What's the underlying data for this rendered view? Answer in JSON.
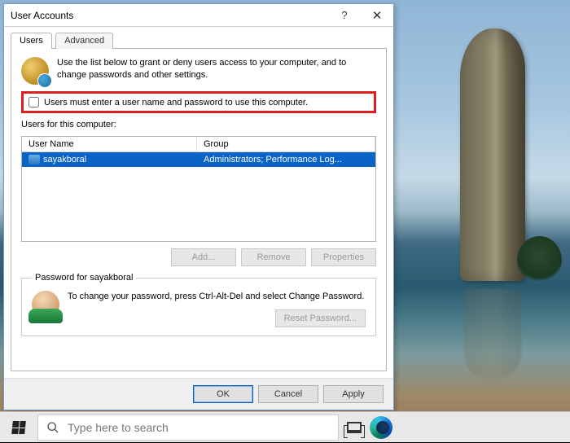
{
  "dialog": {
    "title": "User Accounts",
    "tabs": {
      "users": "Users",
      "advanced": "Advanced"
    },
    "intro": "Use the list below to grant or deny users access to your computer, and to change passwords and other settings.",
    "checkbox_label": "Users must enter a user name and password to use this computer.",
    "users_label": "Users for this computer:",
    "columns": {
      "name": "User Name",
      "group": "Group"
    },
    "rows": [
      {
        "name": "sayakboral",
        "group": "Administrators; Performance Log..."
      }
    ],
    "buttons": {
      "add": "Add...",
      "remove": "Remove",
      "properties": "Properties"
    },
    "password_group": {
      "legend": "Password for sayakboral",
      "text": "To change your password, press Ctrl-Alt-Del and select Change Password.",
      "reset": "Reset Password..."
    },
    "footer": {
      "ok": "OK",
      "cancel": "Cancel",
      "apply": "Apply"
    }
  },
  "taskbar": {
    "search_placeholder": "Type here to search"
  }
}
